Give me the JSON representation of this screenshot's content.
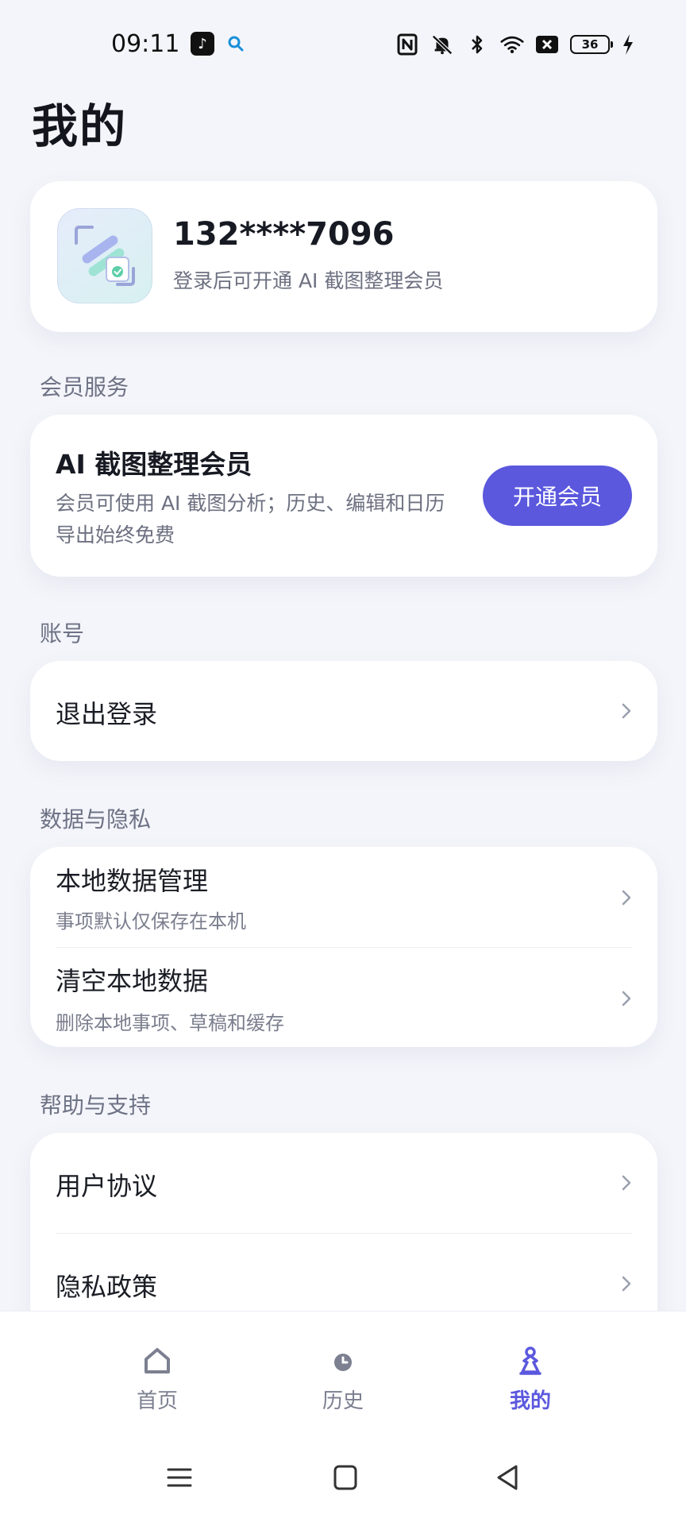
{
  "status_bar": {
    "time": "09:11",
    "battery": "36"
  },
  "page": {
    "title": "我的"
  },
  "profile": {
    "phone": "132****7096",
    "subtitle": "登录后可开通 AI 截图整理会员"
  },
  "sections": {
    "membership": "会员服务",
    "account": "账号",
    "privacy": "数据与隐私",
    "help": "帮助与支持"
  },
  "membership": {
    "title": "AI 截图整理会员",
    "description": "会员可使用 AI 截图分析；历史、编辑和日历导出始终免费",
    "button": "开通会员"
  },
  "account": {
    "logout": "退出登录"
  },
  "privacy": {
    "items": [
      {
        "title": "本地数据管理",
        "subtitle": "事项默认仅保存在本机"
      },
      {
        "title": "清空本地数据",
        "subtitle": "删除本地事项、草稿和缓存"
      }
    ]
  },
  "help": {
    "items": [
      {
        "title": "用户协议"
      },
      {
        "title": "隐私政策"
      }
    ]
  },
  "bottom_nav": {
    "items": [
      {
        "label": "首页",
        "icon": "home-icon"
      },
      {
        "label": "历史",
        "icon": "clock-icon"
      },
      {
        "label": "我的",
        "icon": "user-icon",
        "active": true
      }
    ]
  },
  "colors": {
    "accent": "#5b58de",
    "background": "#f4f5fa",
    "card": "#ffffff",
    "muted_text": "#6c7080"
  }
}
